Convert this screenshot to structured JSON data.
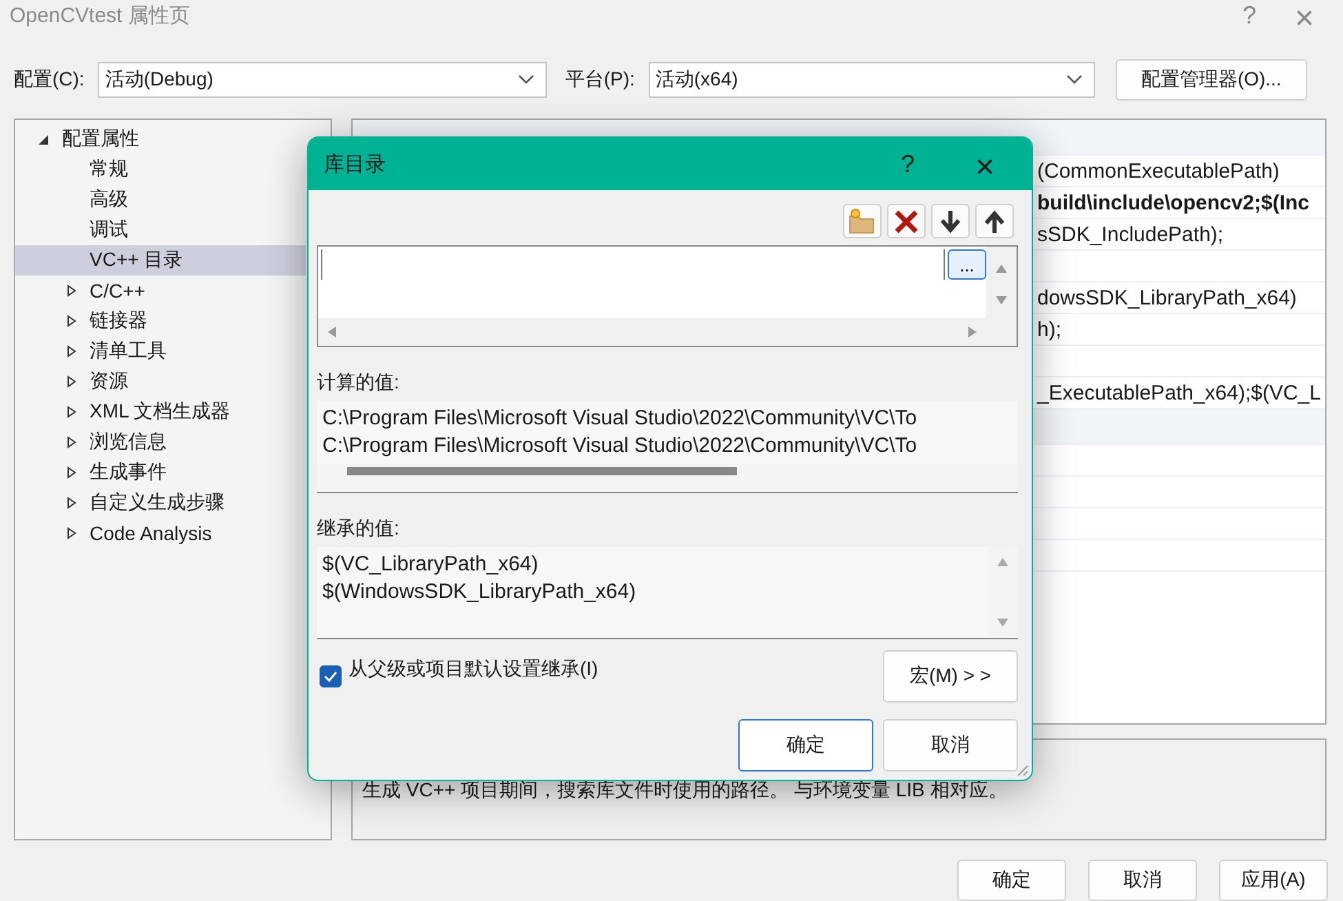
{
  "window": {
    "title": "OpenCVtest 属性页",
    "help": "?",
    "close": "×"
  },
  "config_bar": {
    "config_label": "配置(C):",
    "config_value": "活动(Debug)",
    "platform_label": "平台(P):",
    "platform_value": "活动(x64)",
    "manager_button": "配置管理器(O)..."
  },
  "tree": [
    {
      "label": "配置属性",
      "expanded": true,
      "children": [
        {
          "label": "常规",
          "selected": false
        },
        {
          "label": "高级",
          "selected": false
        },
        {
          "label": "调试",
          "selected": false
        },
        {
          "label": "VC++ 目录",
          "selected": true
        },
        {
          "label": "C/C++",
          "selected": false,
          "expanded": false
        },
        {
          "label": "链接器",
          "selected": false,
          "expanded": false
        },
        {
          "label": "清单工具",
          "selected": false,
          "expanded": false
        },
        {
          "label": "资源",
          "selected": false,
          "expanded": false
        },
        {
          "label": "XML 文档生成器",
          "selected": false,
          "expanded": false
        },
        {
          "label": "浏览信息",
          "selected": false,
          "expanded": false
        },
        {
          "label": "生成事件",
          "selected": false,
          "expanded": false
        },
        {
          "label": "自定义生成步骤",
          "selected": false,
          "expanded": false
        },
        {
          "label": "Code Analysis",
          "selected": false,
          "expanded": false
        }
      ]
    }
  ],
  "property_grid": {
    "rows": [
      {
        "kind": "header"
      },
      {
        "kind": "row",
        "value": "(CommonExecutablePath)",
        "bold": false
      },
      {
        "kind": "row",
        "value": "build\\include\\opencv2;$(Inc",
        "bold": true
      },
      {
        "kind": "row",
        "value": "sSDK_IncludePath);",
        "bold": false
      },
      {
        "kind": "row"
      },
      {
        "kind": "row",
        "value": "dowsSDK_LibraryPath_x64)",
        "bold": false
      },
      {
        "kind": "row",
        "value": "h);",
        "bold": false
      },
      {
        "kind": "row"
      },
      {
        "kind": "row",
        "value": "_ExecutablePath_x64);$(VC_L",
        "bold": false
      },
      {
        "kind": "header"
      },
      {
        "kind": "row"
      },
      {
        "kind": "row"
      },
      {
        "kind": "row"
      },
      {
        "kind": "row"
      }
    ]
  },
  "description": "生成 VC++ 项目期间，搜索库文件时使用的路径。 与环境变量 LIB 相对应。",
  "footer_buttons": [
    {
      "label": "确定"
    },
    {
      "label": "取消"
    },
    {
      "label": "应用(A)"
    }
  ],
  "dialog": {
    "title": "库目录",
    "help": "?",
    "close": "×",
    "edit_row": {
      "browse_button": "..."
    },
    "computed_label": "计算的值:",
    "computed_values": [
      "C:\\Program Files\\Microsoft Visual Studio\\2022\\Community\\VC\\To",
      "C:\\Program Files\\Microsoft Visual Studio\\2022\\Community\\VC\\To"
    ],
    "inherited_label": "继承的值:",
    "inherited_values": [
      "$(VC_LibraryPath_x64)",
      "$(WindowsSDK_LibraryPath_x64)"
    ],
    "inherit_checkbox": {
      "label": "从父级或项目默认设置继承(I)",
      "checked": true
    },
    "macro_button": "宏(M) > >",
    "buttons": [
      {
        "label": "确定",
        "default": true
      },
      {
        "label": "取消",
        "default": false
      }
    ]
  }
}
